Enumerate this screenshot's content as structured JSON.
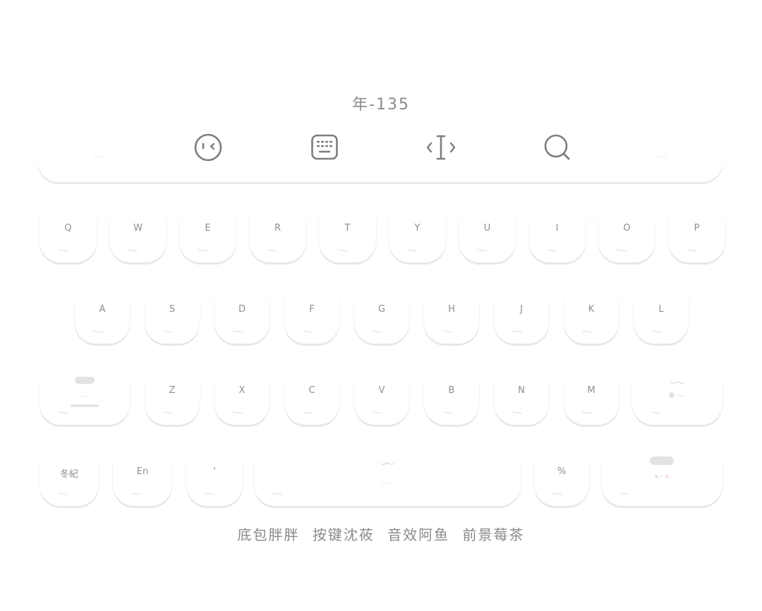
{
  "theme": {
    "title": "年-135"
  },
  "toolbar": {
    "tools": [
      {
        "name": "emoji-face-icon"
      },
      {
        "name": "keyboard-icon"
      },
      {
        "name": "text-cursor-icon"
      },
      {
        "name": "search-icon"
      }
    ]
  },
  "keyboard": {
    "row1": [
      "Q",
      "W",
      "E",
      "R",
      "T",
      "Y",
      "U",
      "I",
      "O",
      "P"
    ],
    "row2": [
      "A",
      "S",
      "D",
      "F",
      "G",
      "H",
      "J",
      "K",
      "L"
    ],
    "row3": [
      "Z",
      "X",
      "C",
      "V",
      "B",
      "N",
      "M"
    ],
    "bottom": {
      "lang_key": "冬紀",
      "en_key": "En",
      "comma_key": "'",
      "percent_key": "%"
    }
  },
  "credits": [
    "底包胖胖",
    "按键沈莜",
    "音效阿鱼",
    "前景莓茶"
  ],
  "colors": {
    "background": "#ffffff",
    "text": "#8a8a8a",
    "key_shadow": "#e8e8e8",
    "blush": "#f2b6c0"
  }
}
